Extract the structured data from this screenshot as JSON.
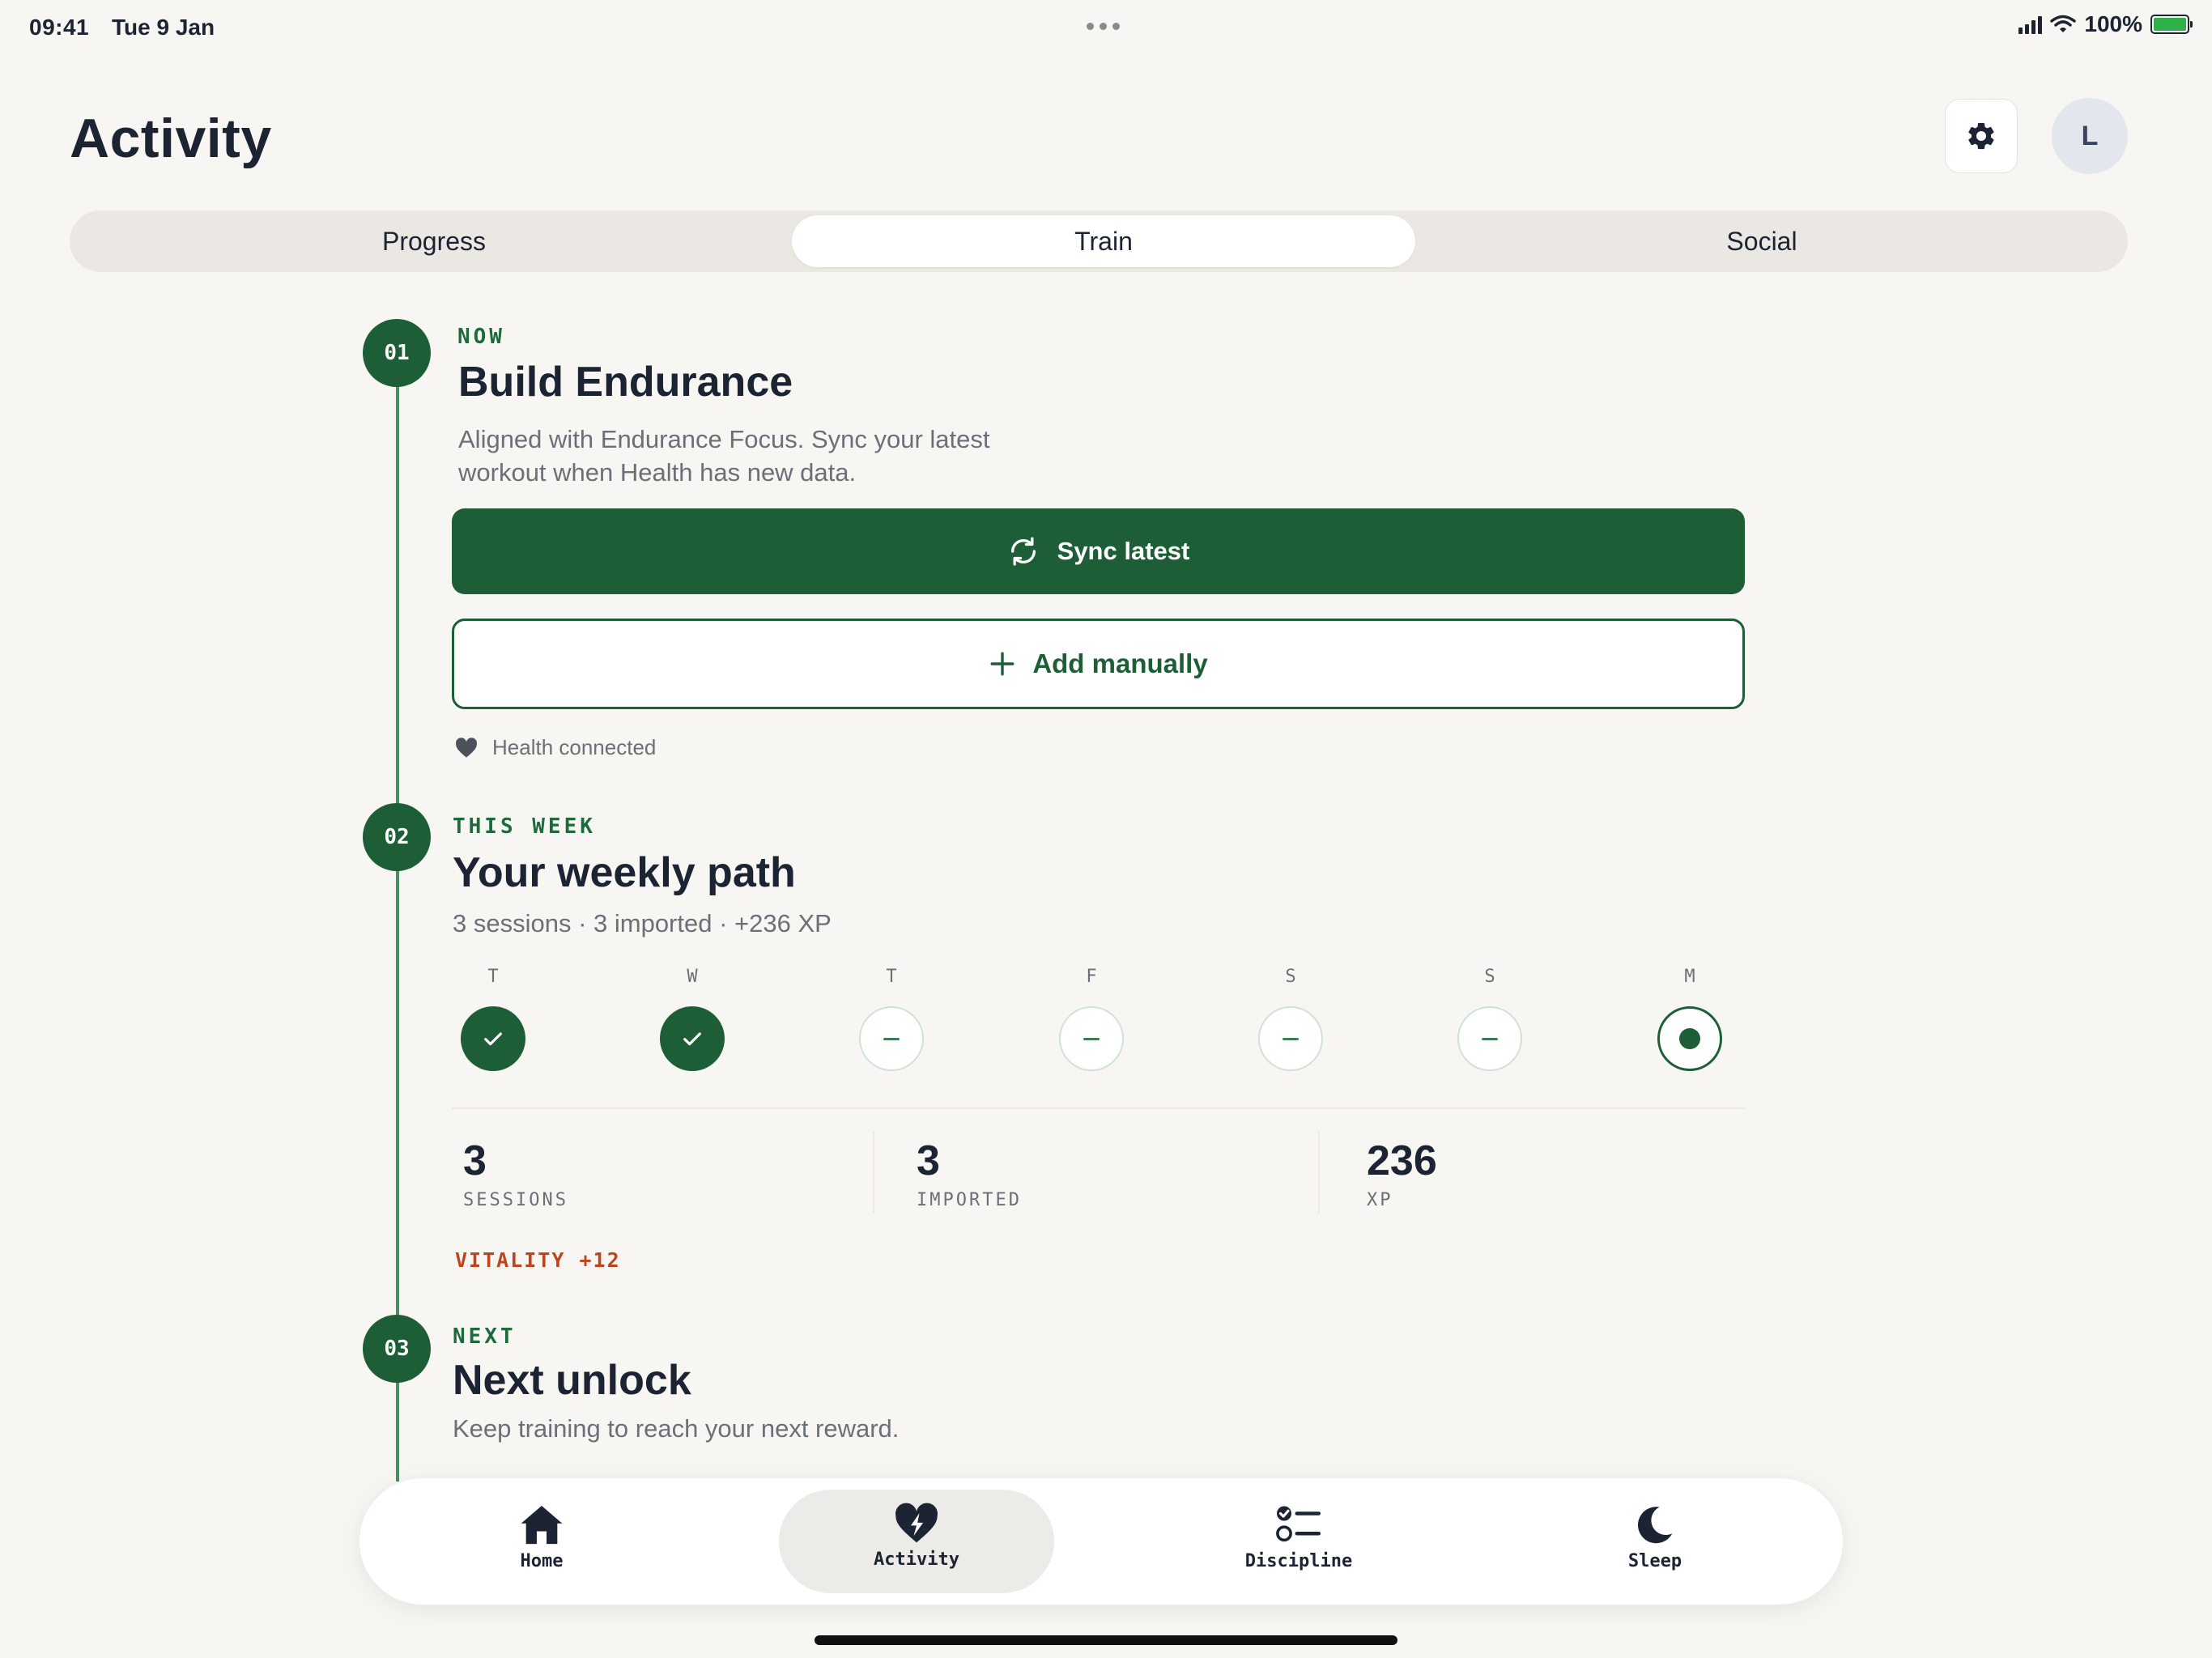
{
  "status_bar": {
    "time": "09:41",
    "date": "Tue 9 Jan",
    "battery": "100%",
    "battery_color": "#2fb04a"
  },
  "header": {
    "title": "Activity",
    "settings_icon": "gear-icon",
    "avatar_initial": "L"
  },
  "tabs": [
    {
      "label": "Progress",
      "active": false
    },
    {
      "label": "Train",
      "active": true
    },
    {
      "label": "Social",
      "active": false
    }
  ],
  "steps": {
    "now": {
      "number": "01",
      "eyebrow": "NOW",
      "title": "Build Endurance",
      "description_line1": "Aligned with Endurance Focus. Sync your latest",
      "description_line2": "workout when Health has new data.",
      "sync_label": "Sync latest",
      "add_label": "Add manually",
      "health_status": "Health connected"
    },
    "week": {
      "number": "02",
      "eyebrow": "THIS WEEK",
      "title": "Your weekly path",
      "summary": "3 sessions · 3 imported · +236 XP",
      "days": [
        {
          "label": "T",
          "state": "done"
        },
        {
          "label": "W",
          "state": "done"
        },
        {
          "label": "T",
          "state": "empty"
        },
        {
          "label": "F",
          "state": "empty"
        },
        {
          "label": "S",
          "state": "empty"
        },
        {
          "label": "S",
          "state": "empty"
        },
        {
          "label": "M",
          "state": "today"
        }
      ],
      "stats": [
        {
          "value": "3",
          "label": "SESSIONS"
        },
        {
          "value": "3",
          "label": "IMPORTED"
        },
        {
          "value": "236",
          "label": "XP"
        }
      ],
      "vitality": "VITALITY +12"
    },
    "next": {
      "number": "03",
      "eyebrow": "NEXT",
      "title": "Next unlock",
      "description": "Keep training to reach your next reward."
    }
  },
  "bottom_nav": [
    {
      "label": "Home",
      "icon": "home-icon",
      "active": false
    },
    {
      "label": "Activity",
      "icon": "heart-bolt-icon",
      "active": true
    },
    {
      "label": "Discipline",
      "icon": "checklist-icon",
      "active": false
    },
    {
      "label": "Sleep",
      "icon": "moon-icon",
      "active": false
    }
  ],
  "colors": {
    "accent": "#1d5e37",
    "background": "#f8f6f2",
    "vitality": "#c0441b"
  }
}
